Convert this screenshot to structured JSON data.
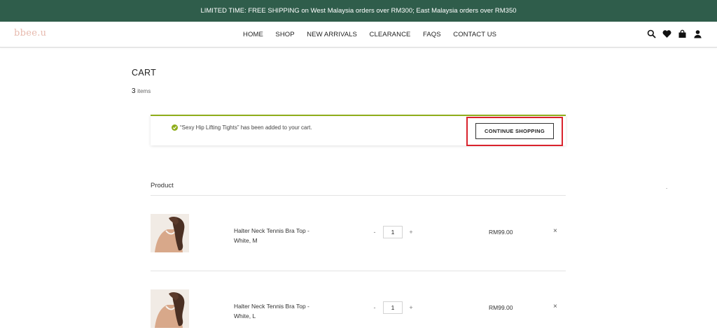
{
  "announcement": "LIMITED TIME: FREE SHIPPING on West Malaysia orders over RM300; East Malaysia orders over RM350",
  "logo": "bbee.u",
  "nav": [
    "HOME",
    "SHOP",
    "NEW ARRIVALS",
    "CLEARANCE",
    "FAQS",
    "CONTACT US"
  ],
  "header_icons": [
    "search-icon",
    "heart-icon",
    "shopping-bag-icon",
    "user-icon"
  ],
  "cart": {
    "title": "CART",
    "count": "3",
    "count_label": "items"
  },
  "notice": {
    "message": "“Sexy Hip Lifting Tights” has been added to your cart.",
    "button": "CONTINUE SHOPPING"
  },
  "table": {
    "product_header": "Product",
    "stray": ".",
    "rows": [
      {
        "name": "Halter Neck Tennis Bra Top - White, M",
        "qty": "1",
        "price": "RM99.00",
        "minus": "-",
        "plus": "+",
        "remove": "×"
      },
      {
        "name": "Halter Neck Tennis Bra Top - White, L",
        "qty": "1",
        "price": "RM99.00",
        "minus": "-",
        "plus": "+",
        "remove": "×"
      }
    ]
  },
  "colors": {
    "topbar": "#2f5d4b",
    "logo": "#e7b9ad",
    "success": "#8fae1b",
    "highlight": "#d9232d"
  }
}
